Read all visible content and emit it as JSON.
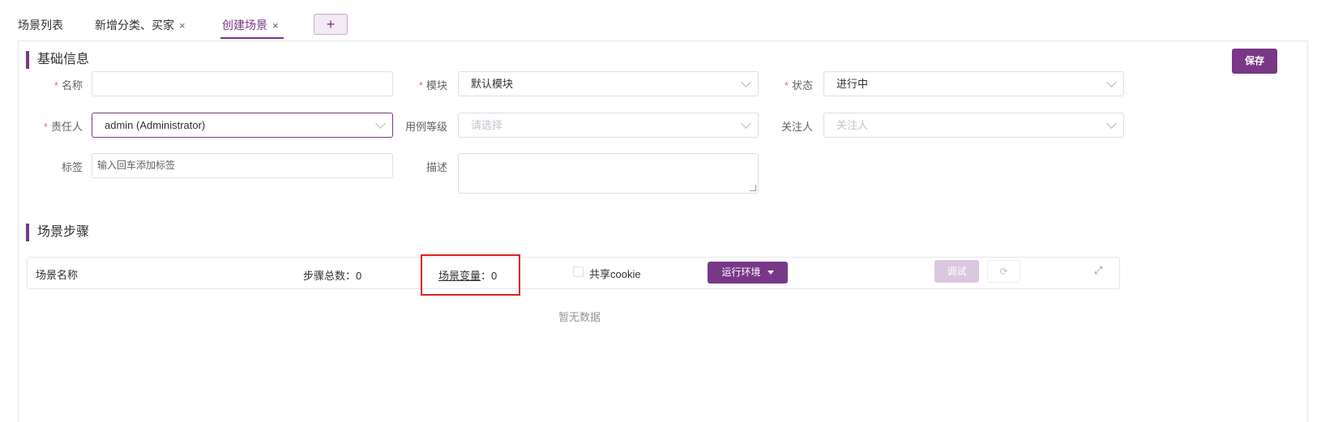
{
  "tabs": [
    {
      "label": "场景列表"
    },
    {
      "label": "新增分类、买家",
      "close": "×"
    },
    {
      "label": "创建场景",
      "close": "×"
    }
  ],
  "tab_add": "+",
  "basic": {
    "title": "基础信息",
    "save": "保存",
    "name_label": "名称",
    "name_value": "",
    "module_label": "模块",
    "module_value": "默认模块",
    "status_label": "状态",
    "status_value": "进行中",
    "owner_label": "责任人",
    "owner_value": "admin (Administrator)",
    "level_label": "用例等级",
    "level_placeholder": "请选择",
    "follower_label": "关注人",
    "follower_placeholder": "关注人",
    "tag_label": "标签",
    "tag_placeholder": "输入回车添加标签",
    "desc_label": "描述",
    "required_mark": "*"
  },
  "steps": {
    "title": "场景步骤",
    "scene_name": "场景名称",
    "step_count_label": "步骤总数：",
    "step_count": "0",
    "var_label": "场景变量",
    "var_sep": "：",
    "var_count": "0",
    "share_cookie": "共享cookie",
    "env_button": "运行环境",
    "debug_button": "调试",
    "refresh_icon": "⟳",
    "expand_icon": "⤢",
    "empty_text": "暂无数据"
  },
  "colors": {
    "accent": "#783887",
    "required": "#f56c6c",
    "highlight": "#e02020"
  }
}
